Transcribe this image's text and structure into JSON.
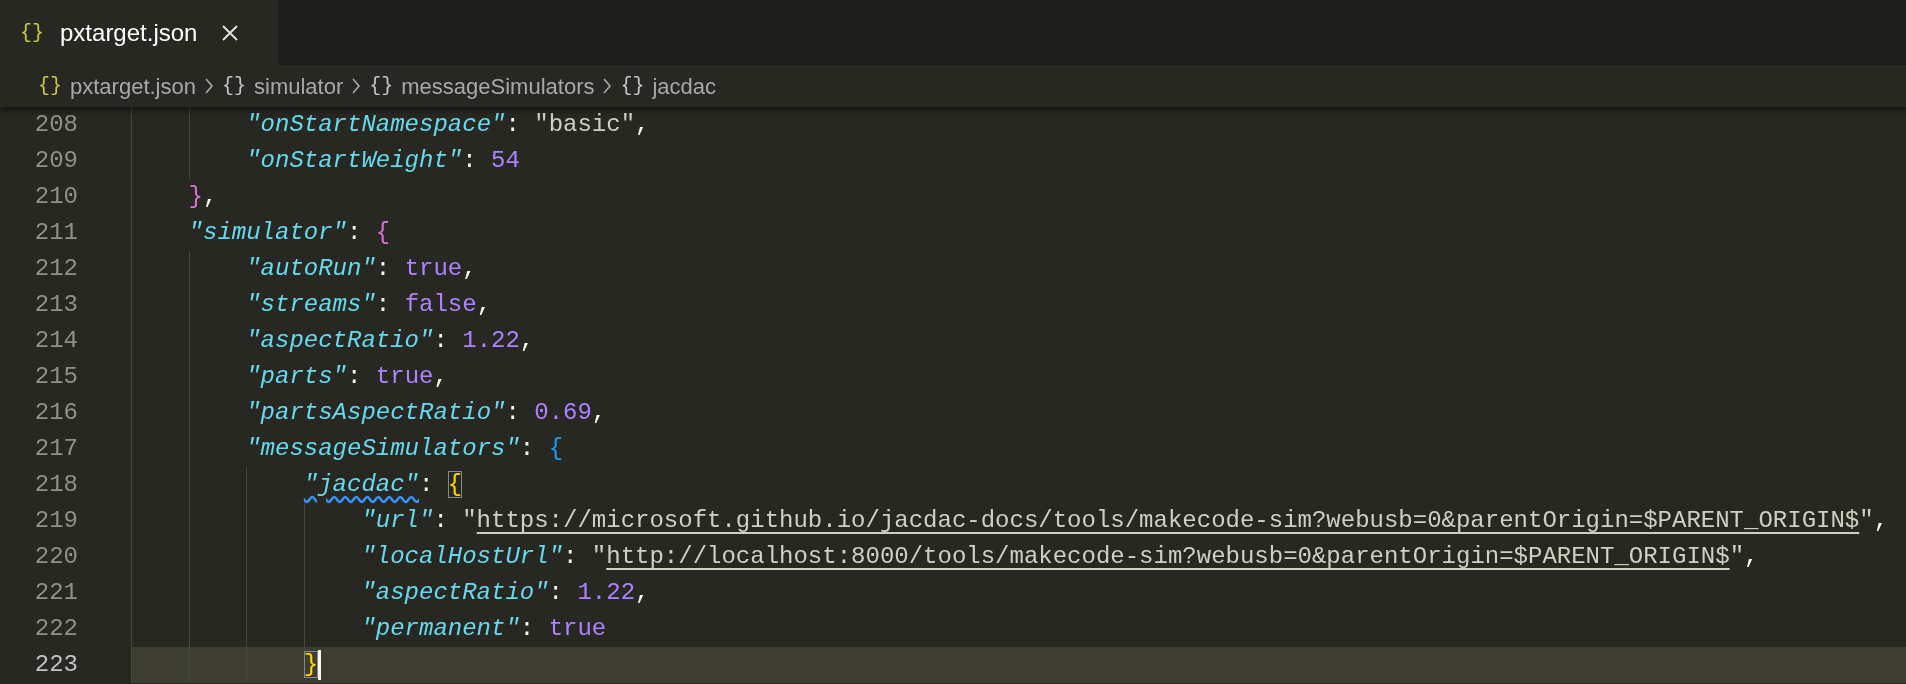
{
  "tabs": [
    {
      "icon": "{}",
      "label": "pxtarget.json",
      "selected": true
    }
  ],
  "breadcrumbs": [
    {
      "kind": "file",
      "icon": "{}",
      "label": "pxtarget.json"
    },
    {
      "kind": "object",
      "icon": "{}",
      "label": "simulator"
    },
    {
      "kind": "object",
      "icon": "{}",
      "label": "messageSimulators"
    },
    {
      "kind": "object",
      "icon": "{}",
      "label": "jacdac"
    }
  ],
  "editor": {
    "lines": [
      {
        "children": [
          {
            "children": [
              {
                "number": "208",
                "current": false,
                "cursor": false,
                "tokens": [
                  {
                    "kind": "key",
                    "text": "\"onStartNamespace\"",
                    "squiggle": false
                  },
                  {
                    "kind": "punct",
                    "text": ": "
                  },
                  {
                    "kind": "string",
                    "text": "\"basic\""
                  },
                  {
                    "kind": "punct",
                    "text": ","
                  }
                ]
              },
              {
                "number": "209",
                "current": false,
                "cursor": false,
                "tokens": [
                  {
                    "kind": "key",
                    "text": "\"onStartWeight\"",
                    "squiggle": false
                  },
                  {
                    "kind": "punct",
                    "text": ": "
                  },
                  {
                    "kind": "number",
                    "text": "54"
                  }
                ]
              }
            ]
          },
          {
            "number": "210",
            "current": false,
            "cursor": false,
            "tokens": [
              {
                "kind": "bracket",
                "text": "}",
                "color": "#da70d6",
                "matched": false
              },
              {
                "kind": "punct",
                "text": ","
              }
            ]
          },
          {
            "number": "211",
            "current": false,
            "cursor": false,
            "tokens": [
              {
                "kind": "key",
                "text": "\"simulator\"",
                "squiggle": false
              },
              {
                "kind": "punct",
                "text": ": "
              },
              {
                "kind": "bracket",
                "text": "{",
                "color": "#da70d6",
                "matched": false
              }
            ],
            "children": [
              {
                "number": "212",
                "current": false,
                "cursor": false,
                "tokens": [
                  {
                    "kind": "key",
                    "text": "\"autoRun\"",
                    "squiggle": false
                  },
                  {
                    "kind": "punct",
                    "text": ": "
                  },
                  {
                    "kind": "number",
                    "text": "true"
                  },
                  {
                    "kind": "punct",
                    "text": ","
                  }
                ]
              },
              {
                "number": "213",
                "current": false,
                "cursor": false,
                "tokens": [
                  {
                    "kind": "key",
                    "text": "\"streams\"",
                    "squiggle": false
                  },
                  {
                    "kind": "punct",
                    "text": ": "
                  },
                  {
                    "kind": "number",
                    "text": "false"
                  },
                  {
                    "kind": "punct",
                    "text": ","
                  }
                ]
              },
              {
                "number": "214",
                "current": false,
                "cursor": false,
                "tokens": [
                  {
                    "kind": "key",
                    "text": "\"aspectRatio\"",
                    "squiggle": false
                  },
                  {
                    "kind": "punct",
                    "text": ": "
                  },
                  {
                    "kind": "number",
                    "text": "1.22"
                  },
                  {
                    "kind": "punct",
                    "text": ","
                  }
                ]
              },
              {
                "number": "215",
                "current": false,
                "cursor": false,
                "tokens": [
                  {
                    "kind": "key",
                    "text": "\"parts\"",
                    "squiggle": false
                  },
                  {
                    "kind": "punct",
                    "text": ": "
                  },
                  {
                    "kind": "number",
                    "text": "true"
                  },
                  {
                    "kind": "punct",
                    "text": ","
                  }
                ]
              },
              {
                "number": "216",
                "current": false,
                "cursor": false,
                "tokens": [
                  {
                    "kind": "key",
                    "text": "\"partsAspectRatio\"",
                    "squiggle": false
                  },
                  {
                    "kind": "punct",
                    "text": ": "
                  },
                  {
                    "kind": "number",
                    "text": "0.69"
                  },
                  {
                    "kind": "punct",
                    "text": ","
                  }
                ]
              },
              {
                "number": "217",
                "current": false,
                "cursor": false,
                "tokens": [
                  {
                    "kind": "key",
                    "text": "\"messageSimulators\"",
                    "squiggle": false
                  },
                  {
                    "kind": "punct",
                    "text": ": "
                  },
                  {
                    "kind": "bracket",
                    "text": "{",
                    "color": "#179fff",
                    "matched": false
                  }
                ],
                "children": [
                  {
                    "number": "218",
                    "current": false,
                    "cursor": false,
                    "tokens": [
                      {
                        "kind": "key",
                        "text": "\"jacdac\"",
                        "squiggle": true
                      },
                      {
                        "kind": "punct",
                        "text": ": "
                      },
                      {
                        "kind": "bracket",
                        "text": "{",
                        "color": "#ffd700",
                        "matched": true
                      }
                    ],
                    "children": [
                      {
                        "number": "219",
                        "current": false,
                        "cursor": false,
                        "tokens": [
                          {
                            "kind": "key",
                            "text": "\"url\"",
                            "squiggle": false
                          },
                          {
                            "kind": "punct",
                            "text": ": "
                          },
                          {
                            "kind": "string",
                            "text": "\""
                          },
                          {
                            "kind": "link",
                            "text": "https://microsoft.github.io/jacdac-docs/tools/makecode-sim?webusb=0&parentOrigin=$PARENT_ORIGIN$"
                          },
                          {
                            "kind": "string",
                            "text": "\""
                          },
                          {
                            "kind": "punct",
                            "text": ","
                          }
                        ]
                      },
                      {
                        "number": "220",
                        "current": false,
                        "cursor": false,
                        "tokens": [
                          {
                            "kind": "key",
                            "text": "\"localHostUrl\"",
                            "squiggle": false
                          },
                          {
                            "kind": "punct",
                            "text": ": "
                          },
                          {
                            "kind": "string",
                            "text": "\""
                          },
                          {
                            "kind": "link",
                            "text": "http://localhost:8000/tools/makecode-sim?webusb=0&parentOrigin=$PARENT_ORIGIN$"
                          },
                          {
                            "kind": "string",
                            "text": "\""
                          },
                          {
                            "kind": "punct",
                            "text": ","
                          }
                        ]
                      },
                      {
                        "number": "221",
                        "current": false,
                        "cursor": false,
                        "tokens": [
                          {
                            "kind": "key",
                            "text": "\"aspectRatio\"",
                            "squiggle": false
                          },
                          {
                            "kind": "punct",
                            "text": ": "
                          },
                          {
                            "kind": "number",
                            "text": "1.22"
                          },
                          {
                            "kind": "punct",
                            "text": ","
                          }
                        ]
                      },
                      {
                        "number": "222",
                        "current": false,
                        "cursor": false,
                        "tokens": [
                          {
                            "kind": "key",
                            "text": "\"permanent\"",
                            "squiggle": false
                          },
                          {
                            "kind": "punct",
                            "text": ": "
                          },
                          {
                            "kind": "number",
                            "text": "true"
                          }
                        ]
                      }
                    ]
                  },
                  {
                    "number": "223",
                    "current": true,
                    "cursor": true,
                    "tokens": [
                      {
                        "kind": "bracket",
                        "text": "}",
                        "color": "#ffd700",
                        "matched": true
                      }
                    ]
                  }
                ]
              }
            ]
          }
        ]
      }
    ]
  }
}
